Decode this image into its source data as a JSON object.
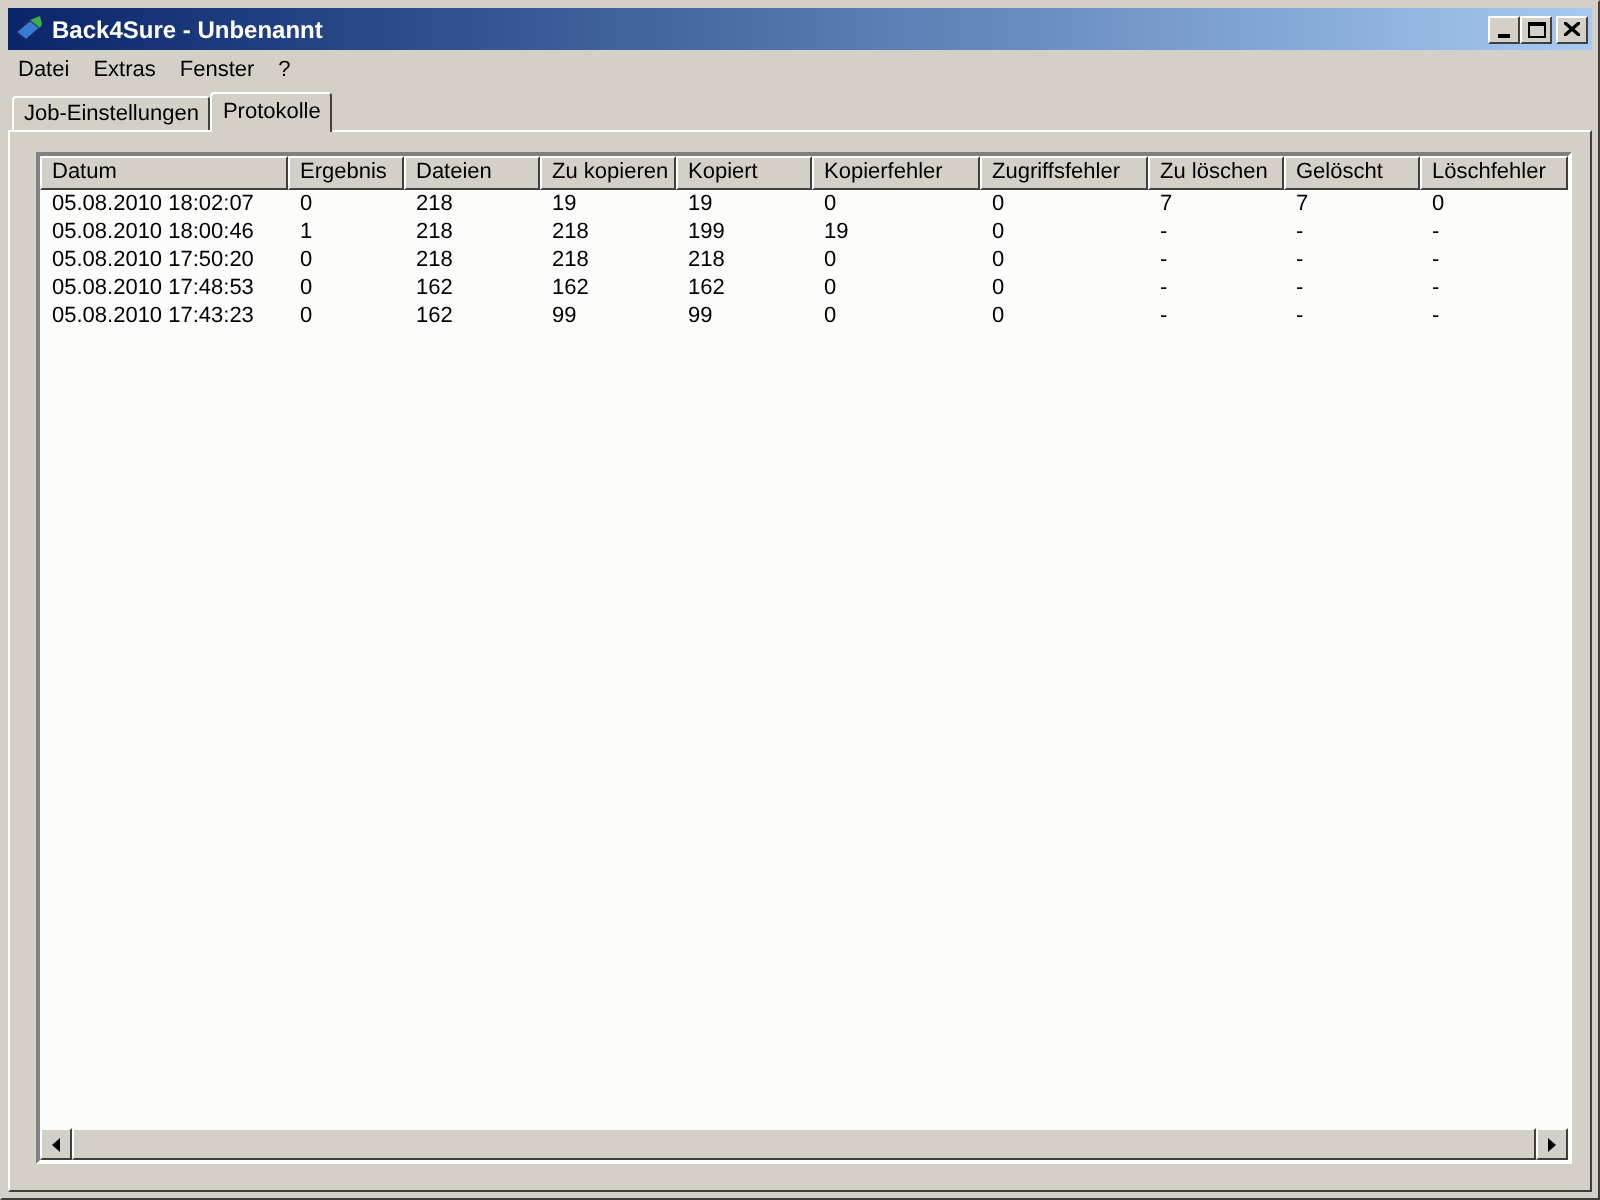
{
  "window": {
    "title": "Back4Sure - Unbenannt"
  },
  "menu": [
    "Datei",
    "Extras",
    "Fenster",
    "?"
  ],
  "tabs": [
    {
      "label": "Job-Einstellungen",
      "selected": false
    },
    {
      "label": "Protokolle",
      "selected": true
    }
  ],
  "table": {
    "columns": [
      "Datum",
      "Ergebnis",
      "Dateien",
      "Zu kopieren",
      "Kopiert",
      "Kopierfehler",
      "Zugriffsfehler",
      "Zu löschen",
      "Gelöscht",
      "Löschfehler"
    ],
    "rows": [
      [
        "05.08.2010 18:02:07",
        "0",
        "218",
        "19",
        "19",
        "0",
        "0",
        "7",
        "7",
        "0"
      ],
      [
        "05.08.2010 18:00:46",
        "1",
        "218",
        "218",
        "199",
        "19",
        "0",
        "-",
        "-",
        "-"
      ],
      [
        "05.08.2010 17:50:20",
        "0",
        "218",
        "218",
        "218",
        "0",
        "0",
        "-",
        "-",
        "-"
      ],
      [
        "05.08.2010 17:48:53",
        "0",
        "162",
        "162",
        "162",
        "0",
        "0",
        "-",
        "-",
        "-"
      ],
      [
        "05.08.2010 17:43:23",
        "0",
        "162",
        "99",
        "99",
        "0",
        "0",
        "-",
        "-",
        "-"
      ]
    ]
  }
}
